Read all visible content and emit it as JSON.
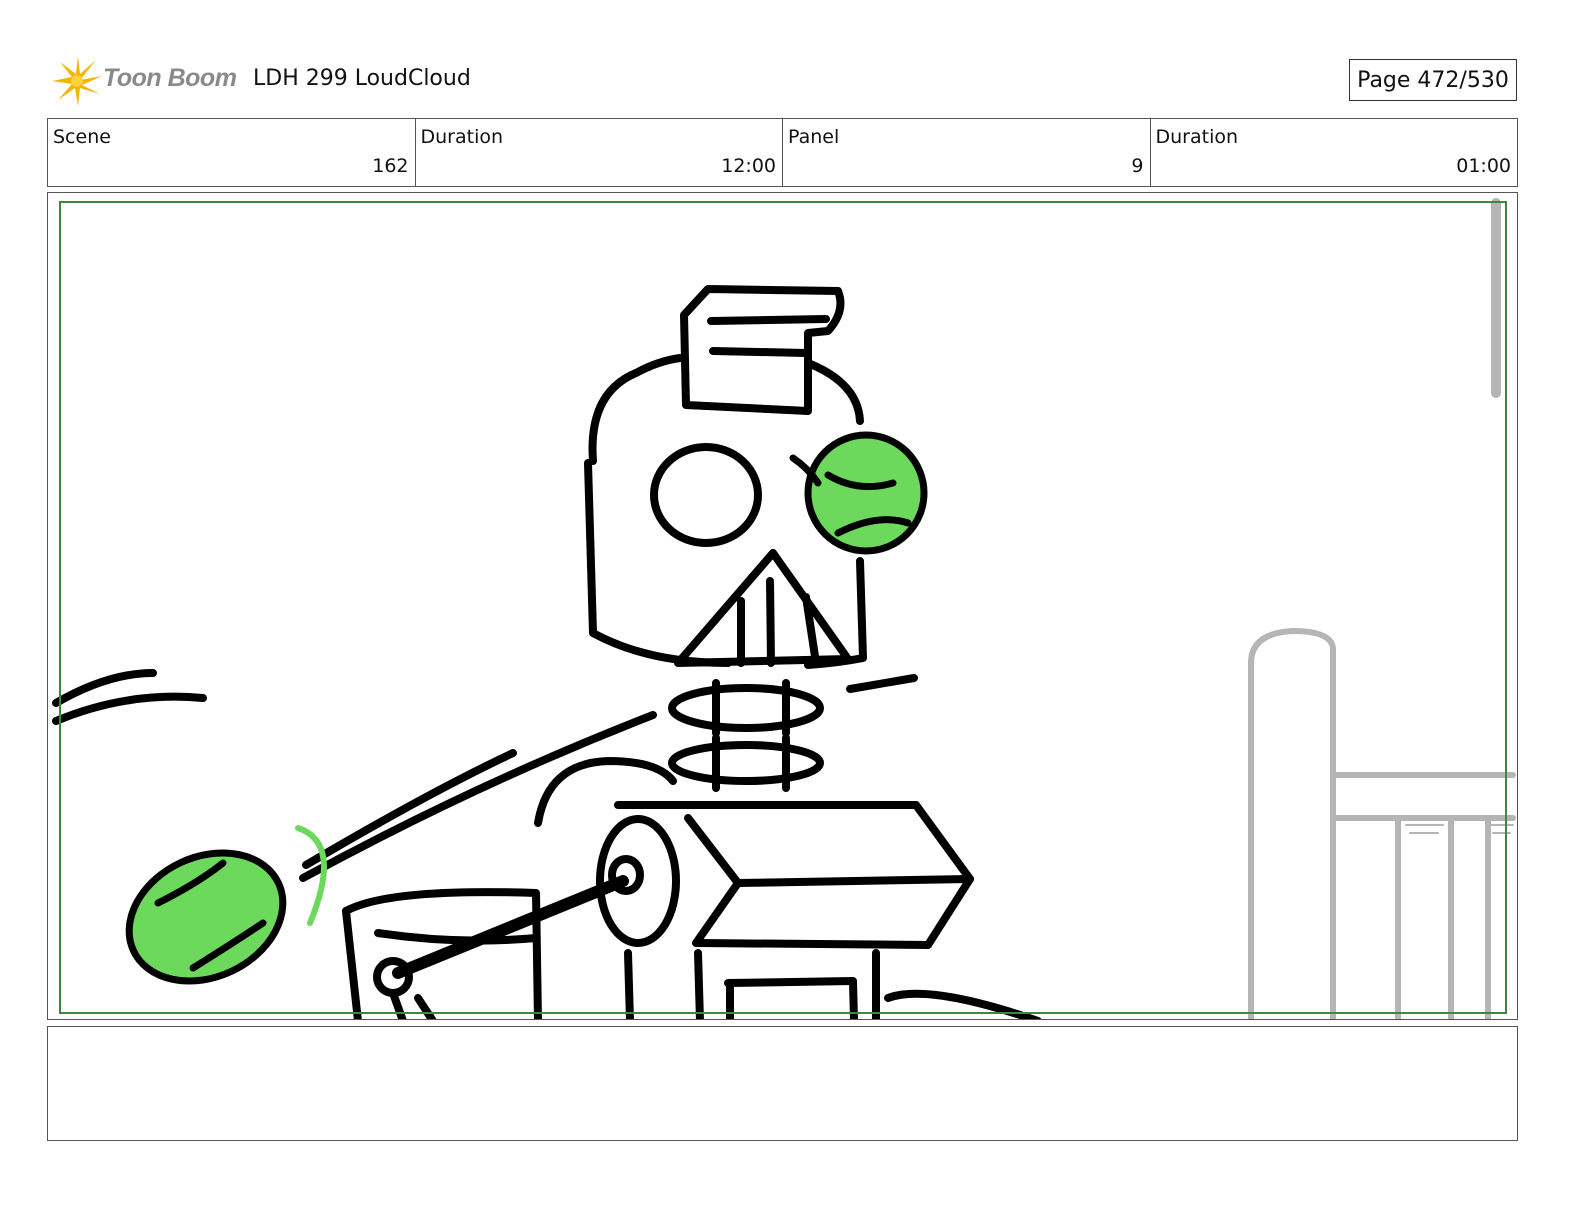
{
  "header": {
    "logo_text": "Toon Boom",
    "logo_icon": "toon-boom-starburst-icon",
    "project_title": "LDH 299 LoudCloud",
    "page_indicator": "Page 472/530"
  },
  "info": {
    "scene_label": "Scene",
    "scene_value": "162",
    "scene_duration_label": "Duration",
    "scene_duration_value": "12:00",
    "panel_label": "Panel",
    "panel_value": "9",
    "panel_duration_label": "Duration",
    "panel_duration_value": "01:00"
  },
  "panel": {
    "safe_frame_color": "#3a8a3a",
    "ball_color": "#6cd95c"
  },
  "notes": {
    "text": ""
  }
}
